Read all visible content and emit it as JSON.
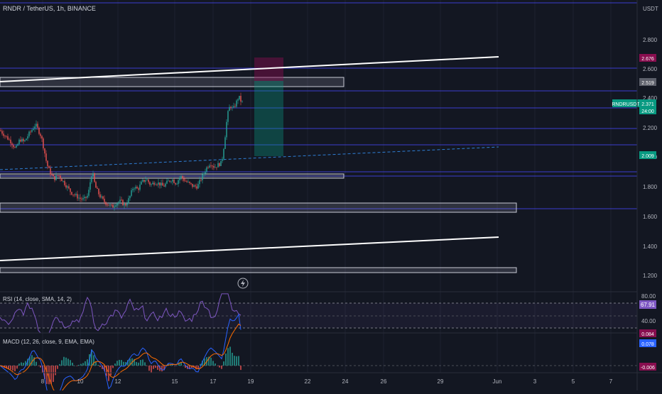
{
  "symbol_header": "RNDR / TetherUS, 1h, BINANCE",
  "currency": "USDT",
  "price_axis": {
    "ticks": [
      "2.800",
      "2.600",
      "2.400",
      "2.200",
      "2.000",
      "1.800",
      "1.600",
      "1.400",
      "1.200"
    ],
    "labels": [
      {
        "text": "2.676",
        "color": "#880e4f"
      },
      {
        "text": "2.519",
        "color": "#5d606b"
      },
      {
        "text": "RNDRUSDT",
        "color": "#089981"
      },
      {
        "text": "2.371",
        "color": "#089981"
      },
      {
        "text": "24:00",
        "color": "#089981"
      },
      {
        "text": "2.009",
        "color": "#089981"
      }
    ]
  },
  "time_axis": [
    "8",
    "10",
    "12",
    "15",
    "17",
    "19",
    "22",
    "24",
    "26",
    "29",
    "Jun",
    "3",
    "5",
    "7"
  ],
  "rsi": {
    "title": "RSI (14, close, SMA, 14, 2)",
    "ticks": [
      "80.00",
      "40.00"
    ],
    "value": "67.91",
    "color": "#7e57c2"
  },
  "macd": {
    "title": "MACD (12, 26, close, 9, EMA, EMA)",
    "values": [
      {
        "text": "0.084",
        "color": "#880e4f"
      },
      {
        "text": "0.078",
        "color": "#2962ff"
      },
      {
        "text": "-0.006",
        "color": "#880e4f"
      }
    ]
  },
  "colors": {
    "up": "#26a69a",
    "down": "#ef5350",
    "background": "#131722",
    "hline": "#3b3ecf"
  },
  "chart_data": {
    "type": "candlestick",
    "title": "RNDR / TetherUS, 1h, BINANCE",
    "ylim": [
      1.1,
      2.95
    ],
    "close_path": [
      [
        0,
        2.18
      ],
      [
        8,
        2.14
      ],
      [
        16,
        2.1
      ],
      [
        22,
        2.05
      ],
      [
        28,
        2.12
      ],
      [
        34,
        2.1
      ],
      [
        40,
        2.15
      ],
      [
        46,
        2.19
      ],
      [
        50,
        2.22
      ],
      [
        54,
        2.18
      ],
      [
        58,
        2.14
      ],
      [
        62,
        2.05
      ],
      [
        66,
        1.95
      ],
      [
        70,
        1.9
      ],
      [
        76,
        1.85
      ],
      [
        82,
        1.88
      ],
      [
        88,
        1.84
      ],
      [
        94,
        1.8
      ],
      [
        100,
        1.76
      ],
      [
        106,
        1.74
      ],
      [
        112,
        1.72
      ],
      [
        118,
        1.71
      ],
      [
        124,
        1.74
      ],
      [
        128,
        1.86
      ],
      [
        130,
        1.9
      ],
      [
        134,
        1.8
      ],
      [
        140,
        1.74
      ],
      [
        146,
        1.7
      ],
      [
        152,
        1.68
      ],
      [
        158,
        1.66
      ],
      [
        164,
        1.69
      ],
      [
        170,
        1.7
      ],
      [
        176,
        1.67
      ],
      [
        182,
        1.72
      ],
      [
        188,
        1.8
      ],
      [
        194,
        1.78
      ],
      [
        200,
        1.83
      ],
      [
        206,
        1.85
      ],
      [
        212,
        1.81
      ],
      [
        218,
        1.83
      ],
      [
        224,
        1.82
      ],
      [
        230,
        1.8
      ],
      [
        236,
        1.83
      ],
      [
        242,
        1.85
      ],
      [
        248,
        1.82
      ],
      [
        254,
        1.87
      ],
      [
        260,
        1.84
      ],
      [
        266,
        1.82
      ],
      [
        272,
        1.8
      ],
      [
        278,
        1.8
      ],
      [
        284,
        1.86
      ],
      [
        290,
        1.92
      ],
      [
        296,
        1.96
      ],
      [
        302,
        1.93
      ],
      [
        308,
        1.95
      ],
      [
        312,
        1.96
      ],
      [
        316,
        2.1
      ],
      [
        320,
        2.28
      ],
      [
        324,
        2.35
      ],
      [
        328,
        2.32
      ],
      [
        332,
        2.36
      ],
      [
        336,
        2.41
      ],
      [
        340,
        2.37
      ]
    ]
  }
}
